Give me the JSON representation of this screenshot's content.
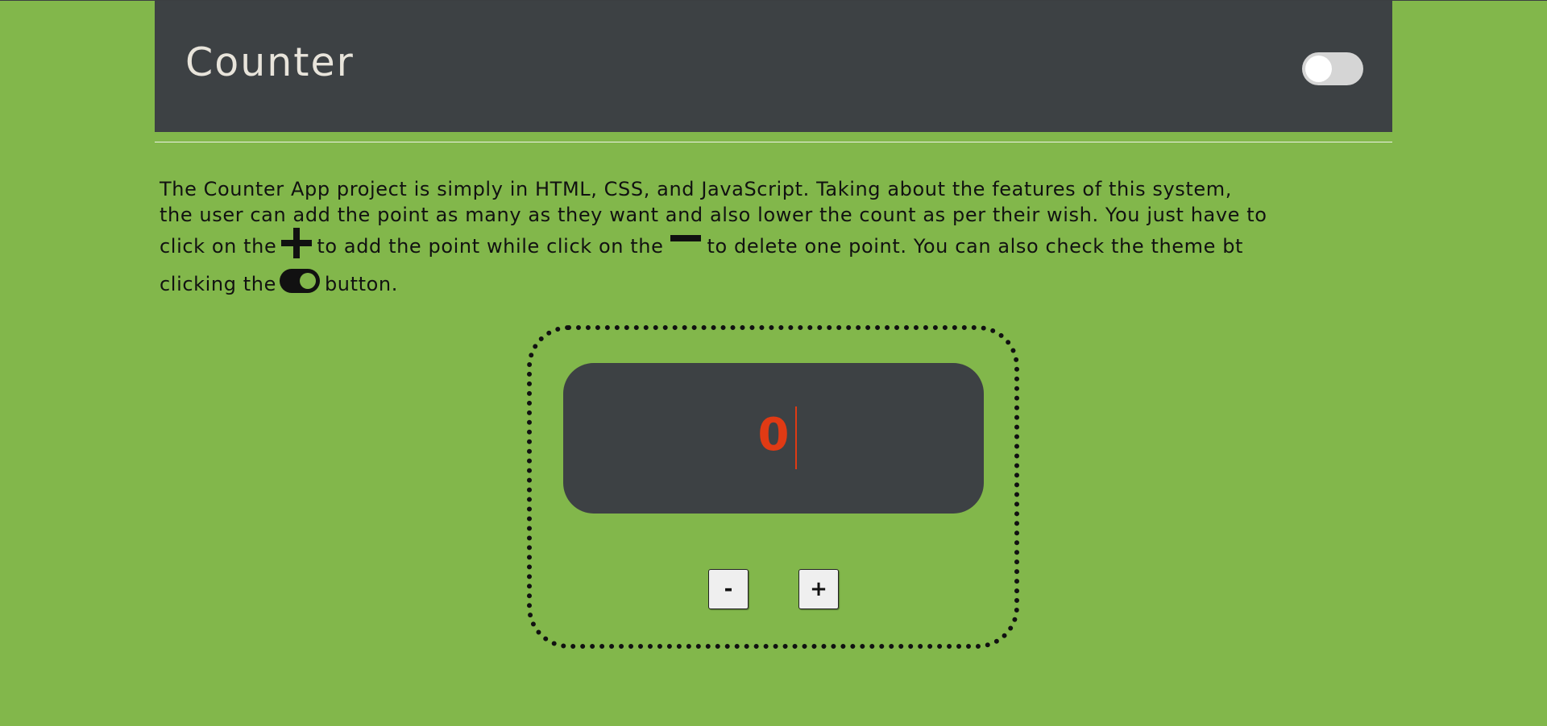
{
  "header": {
    "title": "Counter",
    "theme_toggle_on": false
  },
  "description": {
    "line1": "The Counter App project is simply in HTML, CSS, and JavaScript. Taking about the features of this system,",
    "line2": "the user can add the point as many as they want and also lower the count as per their wish. You just have to",
    "line3a": "click on the",
    "line3b": "to add the point while click on the",
    "line3c": "to delete one point. You can also check the theme bt",
    "line4a": "clicking the",
    "line4b": "button.",
    "icons": [
      "plus-icon",
      "minus-icon",
      "toggle-icon"
    ]
  },
  "counter": {
    "value": "0"
  },
  "buttons": {
    "decrement": "-",
    "increment": "+"
  },
  "colors": {
    "background": "#82b74b",
    "header": "#3d4144",
    "display": "#3d4144",
    "counter_text": "#e03a14",
    "title_text": "#e8e4db"
  }
}
